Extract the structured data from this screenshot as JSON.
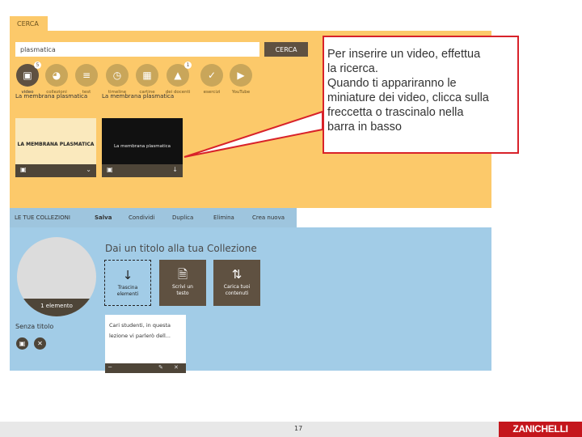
{
  "search": {
    "tab_label": "CERCA",
    "query": "plasmatica",
    "button_label": "CERCA"
  },
  "categories": [
    {
      "label": "video",
      "icon": "video-icon",
      "active": true,
      "badge": "5"
    },
    {
      "label": "collezioni",
      "icon": "collections-icon"
    },
    {
      "label": "test",
      "icon": "test-icon"
    },
    {
      "label": "timeline",
      "icon": "timeline-icon"
    },
    {
      "label": "cartine",
      "icon": "map-icon"
    },
    {
      "label": "dei docenti",
      "icon": "graduation-cap-icon",
      "badge": "1"
    },
    {
      "label": "esercizi",
      "icon": "exercise-icon"
    },
    {
      "label": "YouTube",
      "icon": "youtube-icon"
    }
  ],
  "results": [
    {
      "thumb_title": "LA MEMBRANA PLASMATICA",
      "caption": "La membrana plasmatica"
    },
    {
      "thumb_title": "La membrana plasmatica",
      "caption": "La membrana plasmatica"
    }
  ],
  "collections": {
    "tabs": [
      "LE TUE COLLEZIONI",
      "Salva",
      "Condividi",
      "Duplica",
      "Elimina",
      "Crea nuova"
    ],
    "element_count": "1 elemento",
    "collection_name": "Senza titolo",
    "heading": "Dai un titolo alla tua Collezione",
    "actions": [
      {
        "line1": "Trascina",
        "line2": "elementi",
        "icon": "arrow-down-icon"
      },
      {
        "line1": "Scrivi un",
        "line2": "testo",
        "icon": "document-icon"
      },
      {
        "line1": "Carica tuoi",
        "line2": "contenuti",
        "icon": "upload-icon"
      }
    ],
    "note_line1": "Cari studenti, in questa",
    "note_line2": "lezione vi parlerò dell..."
  },
  "callout": {
    "line1": "Per inserire un video, effettua",
    "line2": "la ricerca.",
    "line3": "Quando ti appariranno le",
    "line4": "miniature dei video, clicca sulla",
    "line5": "freccetta o trascinalo nella",
    "line6": "barra in basso"
  },
  "footer": {
    "page_number": "17",
    "brand": "ZANICHELLI"
  },
  "colors": {
    "search_panel": "#fcc96a",
    "collection_panel": "#a2cce7",
    "dark_brown": "#5f5141",
    "callout_border": "#d8222a",
    "brand_red": "#c4161c"
  }
}
